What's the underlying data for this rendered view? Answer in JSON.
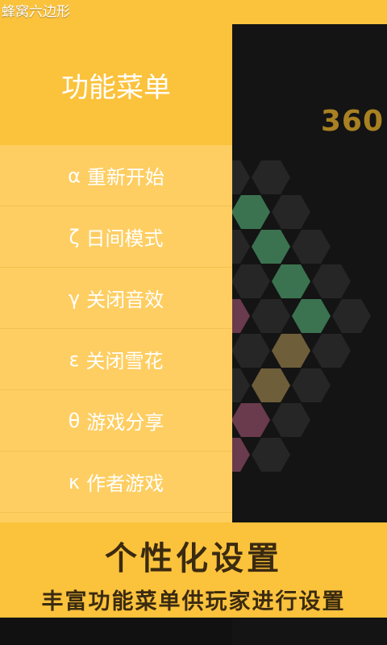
{
  "app": {
    "title": "蜂窝六边形"
  },
  "game": {
    "score": "360",
    "colors": {
      "empty": "#262626",
      "green": "#3b7350",
      "brown": "#6e5e3a",
      "pink": "#6a3a4d"
    }
  },
  "drawer": {
    "title": "功能菜单",
    "items": [
      {
        "symbol": "α",
        "label": "重新开始"
      },
      {
        "symbol": "ζ",
        "label": "日间模式"
      },
      {
        "symbol": "γ",
        "label": "关闭音效"
      },
      {
        "symbol": "ε",
        "label": "关闭雪花"
      },
      {
        "symbol": "θ",
        "label": "游戏分享"
      },
      {
        "symbol": "κ",
        "label": "作者游戏"
      }
    ]
  },
  "banner": {
    "headline": "个性化设置",
    "subtitle": "丰富功能菜单供玩家进行设置"
  }
}
